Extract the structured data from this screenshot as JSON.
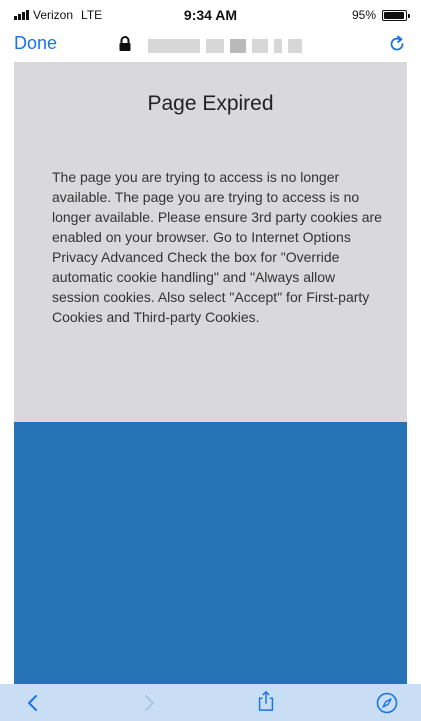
{
  "status_bar": {
    "carrier": "Verizon",
    "network": "LTE",
    "time": "9:34 AM",
    "battery_percent": "95%",
    "battery_level": 0.95
  },
  "nav_bar": {
    "done_label": "Done",
    "lock_icon": "lock-icon",
    "reload_icon": "reload-icon"
  },
  "page": {
    "title": "Page Expired",
    "message": "The page you are trying to access is no longer available. The page you are trying to access is no longer available. Please ensure 3rd party cookies are enabled on your browser. Go to Internet Options Privacy Advanced Check the box for \"Override automatic cookie handling\" and \"Always allow session cookies. Also select \"Accept\" for First-party Cookies and Third-party Cookies."
  },
  "toolbar": {
    "icons": [
      "back-icon",
      "forward-icon",
      "share-icon",
      "safari-compass-icon"
    ]
  },
  "colors": {
    "accent": "#1a73e8",
    "page_gray": "#d9d9db",
    "page_blue": "#2673b6",
    "toolbar_bg": "#c9def4"
  }
}
